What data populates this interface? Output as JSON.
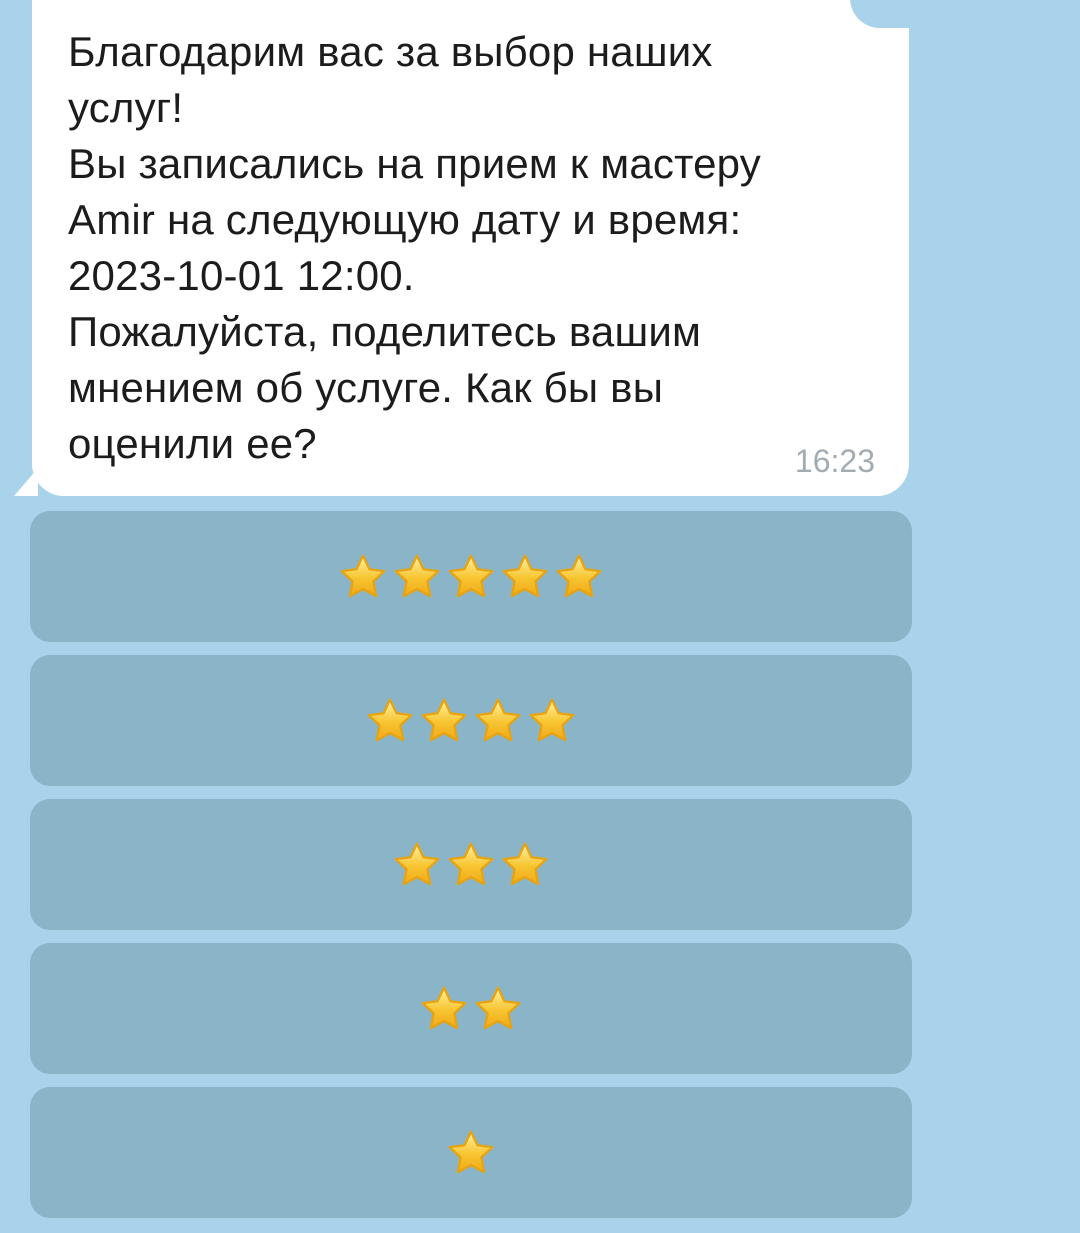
{
  "message": {
    "text": "Благодарим вас за выбор наших\nуслуг!\nВы записались на прием к мастеру\nAmir на следующую дату и время:\n2023-10-01 12:00.\nПожалуйста, поделитесь вашим\nмнением об услуге. Как бы вы\nоценили ее?",
    "time": "16:23"
  },
  "rating_buttons": [
    {
      "stars": 5,
      "icon": "star-icon"
    },
    {
      "stars": 4,
      "icon": "star-icon"
    },
    {
      "stars": 3,
      "icon": "star-icon"
    },
    {
      "stars": 2,
      "icon": "star-icon"
    },
    {
      "stars": 1,
      "icon": "star-icon"
    }
  ],
  "colors": {
    "chat_background": "#a8d3ea",
    "bubble": "#ffffff",
    "button": "#8ab5c9",
    "star_fill": "#f7c531",
    "star_outline": "#e8a30e"
  }
}
